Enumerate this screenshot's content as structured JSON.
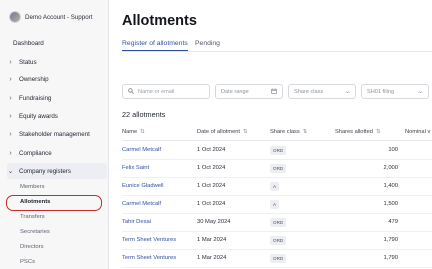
{
  "sidebar": {
    "account_name": "Demo Account - Support",
    "dashboard_label": "Dashboard",
    "items": [
      {
        "label": "Status"
      },
      {
        "label": "Ownership"
      },
      {
        "label": "Fundraising"
      },
      {
        "label": "Equity awards"
      },
      {
        "label": "Stakeholder management"
      },
      {
        "label": "Compliance"
      },
      {
        "label": "Company registers"
      }
    ],
    "subitems": [
      {
        "label": "Members"
      },
      {
        "label": "Allotments"
      },
      {
        "label": "Transfers"
      },
      {
        "label": "Secretaries"
      },
      {
        "label": "Directors"
      },
      {
        "label": "PSCs"
      }
    ]
  },
  "main": {
    "title": "Allotments",
    "tabs": [
      {
        "label": "Register of allotments"
      },
      {
        "label": "Pending"
      }
    ],
    "filters": {
      "search_placeholder": "Name or email",
      "date_range": "Date range",
      "share_class": "Share class",
      "filing": "SH01 filing"
    },
    "count_label": "22 allotments",
    "columns": [
      "Name",
      "Date of allotment",
      "Share class",
      "Shares allotted",
      "Nominal v"
    ],
    "rows": [
      {
        "name": "Carmel Metcalf",
        "date": "1 Oct 2024",
        "share_class": "ORD",
        "shares": "100"
      },
      {
        "name": "Felix Saint",
        "date": "1 Oct 2024",
        "share_class": "ORD",
        "shares": "2,000"
      },
      {
        "name": "Eunice Gladwell",
        "date": "1 Oct 2024",
        "share_class": "A",
        "shares": "1,400"
      },
      {
        "name": "Carmel Metcalf",
        "date": "1 Oct 2024",
        "share_class": "A",
        "shares": "1,500"
      },
      {
        "name": "Tahir Desai",
        "date": "30 May 2024",
        "share_class": "ORD",
        "shares": "479"
      },
      {
        "name": "Term Sheet Ventures",
        "date": "1 Mar 2024",
        "share_class": "ORD",
        "shares": "1,790"
      },
      {
        "name": "Term Sheet Ventures",
        "date": "1 Mar 2024",
        "share_class": "ORD",
        "shares": "1,790"
      }
    ]
  },
  "colors": {
    "accent": "#2f4fa0",
    "highlight_outline": "#c92a2a",
    "sidebar_bg": "#f7f7f8"
  }
}
